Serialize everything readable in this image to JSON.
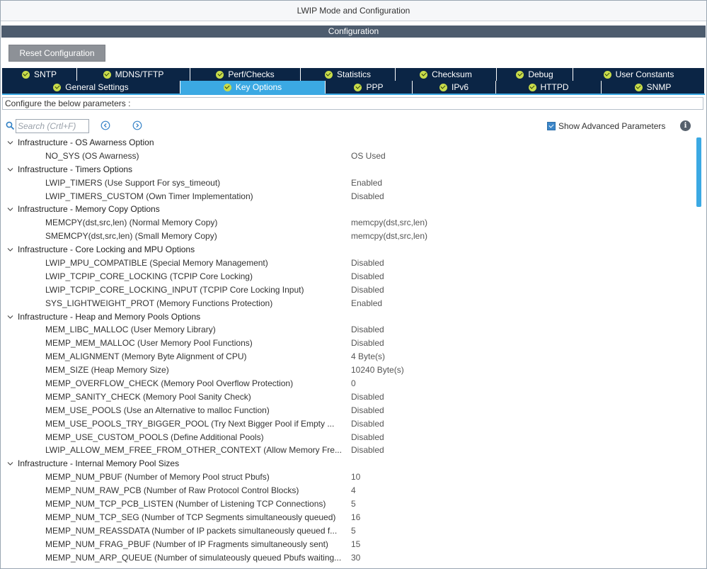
{
  "window": {
    "title": "LWIP Mode and Configuration"
  },
  "config": {
    "header": "Configuration",
    "reset_label": "Reset Configuration",
    "hint": "Configure the below parameters :"
  },
  "tabs": {
    "row1": [
      {
        "label": "SNTP"
      },
      {
        "label": "MDNS/TFTP"
      },
      {
        "label": "Perf/Checks"
      },
      {
        "label": "Statistics"
      },
      {
        "label": "Checksum"
      },
      {
        "label": "Debug"
      },
      {
        "label": "User Constants"
      }
    ],
    "row2": [
      {
        "label": "General Settings"
      },
      {
        "label": "Key Options"
      },
      {
        "label": "PPP"
      },
      {
        "label": "IPv6"
      },
      {
        "label": "HTTPD"
      },
      {
        "label": "SNMP"
      }
    ],
    "active": "Key Options"
  },
  "search": {
    "placeholder": "Search (Crtl+F)"
  },
  "advanced": {
    "label": "Show Advanced Parameters",
    "checked": true
  },
  "colors": {
    "tab_bg": "#0b2545",
    "tab_active": "#3ba9e3",
    "header_bg": "#4d5c6e",
    "check_dot": "#c8dc4a"
  },
  "groups": [
    {
      "title": "Infrastructure - OS Awarness Option",
      "params": [
        {
          "name": "NO_SYS (OS Awarness)",
          "value": "OS Used"
        }
      ]
    },
    {
      "title": "Infrastructure - Timers Options",
      "params": [
        {
          "name": "LWIP_TIMERS (Use Support For sys_timeout)",
          "value": "Enabled"
        },
        {
          "name": "LWIP_TIMERS_CUSTOM (Own Timer Implementation)",
          "value": "Disabled"
        }
      ]
    },
    {
      "title": "Infrastructure - Memory Copy Options",
      "params": [
        {
          "name": "MEMCPY(dst,src,len) (Normal Memory Copy)",
          "value": "memcpy(dst,src,len)"
        },
        {
          "name": "SMEMCPY(dst,src,len) (Small Memory Copy)",
          "value": "memcpy(dst,src,len)"
        }
      ]
    },
    {
      "title": "Infrastructure - Core Locking and MPU Options",
      "params": [
        {
          "name": "LWIP_MPU_COMPATIBLE (Special Memory Management)",
          "value": "Disabled"
        },
        {
          "name": "LWIP_TCPIP_CORE_LOCKING (TCPIP Core Locking)",
          "value": "Disabled"
        },
        {
          "name": "LWIP_TCPIP_CORE_LOCKING_INPUT (TCPIP Core Locking Input)",
          "value": "Disabled"
        },
        {
          "name": "SYS_LIGHTWEIGHT_PROT (Memory Functions Protection)",
          "value": "Enabled"
        }
      ]
    },
    {
      "title": "Infrastructure - Heap and Memory Pools Options",
      "params": [
        {
          "name": "MEM_LIBC_MALLOC (User Memory Library)",
          "value": "Disabled"
        },
        {
          "name": "MEMP_MEM_MALLOC (User Memory Pool Functions)",
          "value": "Disabled"
        },
        {
          "name": "MEM_ALIGNMENT (Memory Byte Alignment of CPU)",
          "value": "4 Byte(s)"
        },
        {
          "name": "MEM_SIZE (Heap Memory Size)",
          "value": "10240 Byte(s)"
        },
        {
          "name": "MEMP_OVERFLOW_CHECK (Memory Pool Overflow Protection)",
          "value": "0"
        },
        {
          "name": "MEMP_SANITY_CHECK (Memory Pool Sanity Check)",
          "value": "Disabled"
        },
        {
          "name": "MEM_USE_POOLS (Use an Alternative to malloc Function)",
          "value": "Disabled"
        },
        {
          "name": "MEM_USE_POOLS_TRY_BIGGER_POOL (Try Next Bigger Pool if Empty ...",
          "value": "Disabled"
        },
        {
          "name": "MEMP_USE_CUSTOM_POOLS (Define Additional Pools)",
          "value": "Disabled"
        },
        {
          "name": "LWIP_ALLOW_MEM_FREE_FROM_OTHER_CONTEXT (Allow Memory Fre...",
          "value": "Disabled"
        }
      ]
    },
    {
      "title": "Infrastructure - Internal Memory Pool Sizes",
      "params": [
        {
          "name": "MEMP_NUM_PBUF (Number of Memory Pool struct Pbufs)",
          "value": "10"
        },
        {
          "name": "MEMP_NUM_RAW_PCB (Number of Raw Protocol Control Blocks)",
          "value": "4"
        },
        {
          "name": "MEMP_NUM_TCP_PCB_LISTEN (Number of Listening TCP Connections)",
          "value": "5"
        },
        {
          "name": "MEMP_NUM_TCP_SEG (Number of TCP Segments simultaneously queued)",
          "value": "16"
        },
        {
          "name": "MEMP_NUM_REASSDATA (Number of IP packets simultaneously queued f...",
          "value": "5"
        },
        {
          "name": "MEMP_NUM_FRAG_PBUF (Number of IP Fragments simultaneously sent)",
          "value": "15"
        },
        {
          "name": "MEMP_NUM_ARP_QUEUE (Number of simulateously queued Pbufs waiting...",
          "value": "30"
        }
      ]
    }
  ]
}
